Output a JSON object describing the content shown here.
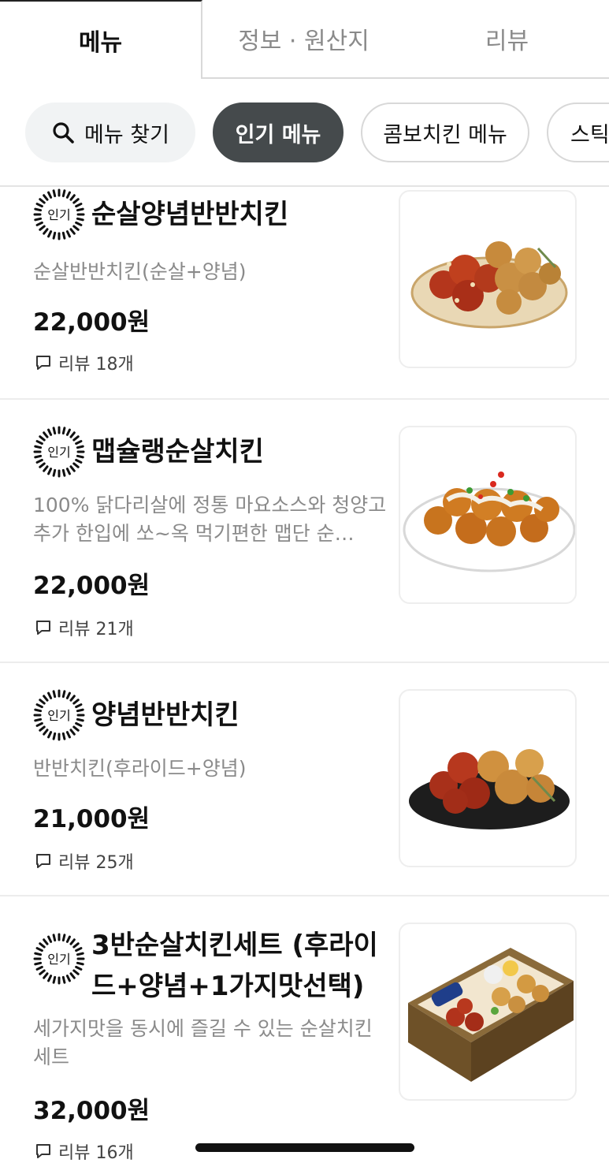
{
  "tabs": [
    {
      "label": "메뉴",
      "active": true
    },
    {
      "label": "정보 · 원산지",
      "active": false
    },
    {
      "label": "리뷰",
      "active": false
    }
  ],
  "chips": {
    "search_label": "메뉴 찾기",
    "items": [
      "인기 메뉴",
      "콤보치킨 메뉴",
      "스틱치킨"
    ]
  },
  "badge_label": "인기",
  "menu": [
    {
      "name": "순살양념반반치킨",
      "description": "순살반반치킨(순살+양념)",
      "price": "22,000원",
      "review": "리뷰 18개",
      "plate_color": "#e9d8b5"
    },
    {
      "name": "맵슐랭순살치킨",
      "description": "100% 닭다리살에 정통 마요소스와 청양고추가 한입에 쏘~옥 먹기편한 맵단 순…",
      "price": "22,000원",
      "review": "리뷰 21개",
      "plate_color": "#ffffff"
    },
    {
      "name": "양념반반치킨",
      "description": "반반치킨(후라이드+양념)",
      "price": "21,000원",
      "review": "리뷰 25개",
      "plate_color": "#1d1d1d"
    },
    {
      "name": "3반순살치킨세트 (후라이드+양념+1가지맛선택)",
      "description": "세가지맛을 동시에 즐길 수 있는 순살치킨세트",
      "price": "32,000원",
      "review": "리뷰 16개",
      "plate_color": "#7a5a2e"
    }
  ]
}
